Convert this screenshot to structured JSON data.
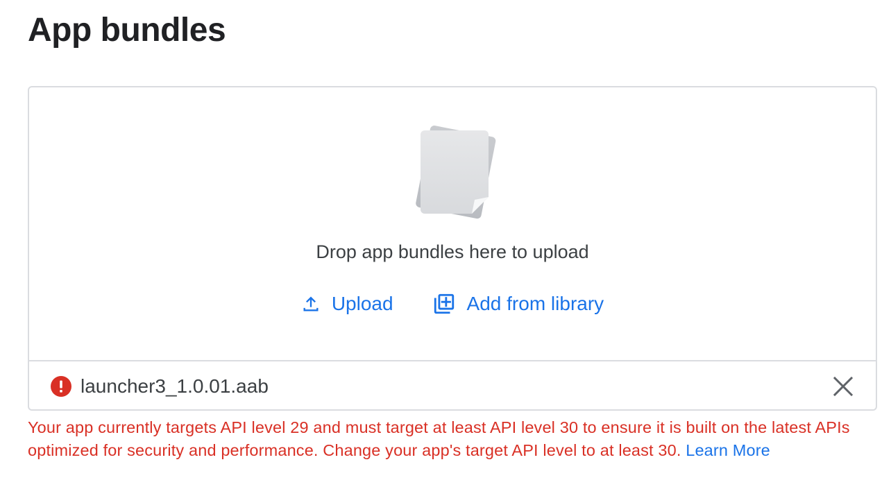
{
  "page": {
    "title": "App bundles"
  },
  "upload": {
    "drop_text": "Drop app bundles here to upload",
    "upload_label": "Upload",
    "library_label": "Add from library"
  },
  "file": {
    "name": "launcher3_1.0.01.aab",
    "status_icon": "error-icon",
    "remove_icon": "close-icon"
  },
  "error": {
    "message": "Your app currently targets API level 29 and must target at least API level 30 to ensure it is built on the latest APIs optimized for security and performance. Change your app's target API level to at least 30.",
    "link_label": "Learn More"
  },
  "colors": {
    "accent": "#1a73e8",
    "error": "#d93025",
    "border": "#dadce0",
    "text": "#202124"
  }
}
